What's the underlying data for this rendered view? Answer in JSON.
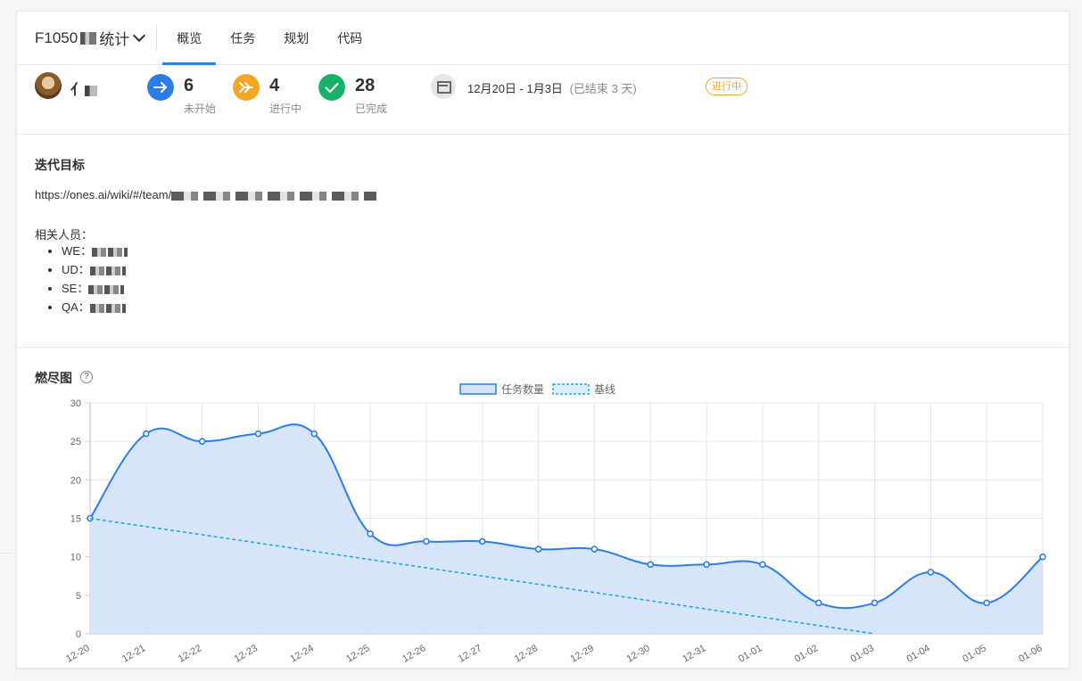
{
  "header": {
    "project_prefix": "F1050",
    "project_suffix": "统计",
    "tabs": [
      {
        "label": "概览",
        "active": true
      },
      {
        "label": "任务",
        "active": false
      },
      {
        "label": "规划",
        "active": false
      },
      {
        "label": "代码",
        "active": false
      }
    ]
  },
  "stats": {
    "not_started": {
      "count": "6",
      "label": "未开始",
      "color": "#2b7de9"
    },
    "in_progress": {
      "count": "4",
      "label": "进行中",
      "color": "#f5a623"
    },
    "done": {
      "count": "28",
      "label": "已完成",
      "color": "#17b26a"
    },
    "date_range": "12月20日 - 1月3日",
    "date_note": "(已结束 3 天)",
    "status": "进行中"
  },
  "goal": {
    "title": "迭代目标",
    "link_prefix": "https://ones.ai/wiki/#/team/",
    "members_label": "相关人员：",
    "members": [
      {
        "role": "WE："
      },
      {
        "role": "UD："
      },
      {
        "role": "SE："
      },
      {
        "role": "QA："
      }
    ]
  },
  "chart_section": {
    "title": "燃尽图",
    "help": "?"
  },
  "chart_data": {
    "type": "line",
    "title": "",
    "xlabel": "",
    "ylabel": "",
    "ylim": [
      0,
      30
    ],
    "yticks": [
      0,
      5,
      10,
      15,
      20,
      25,
      30
    ],
    "categories": [
      "12-20",
      "12-21",
      "12-22",
      "12-23",
      "12-24",
      "12-25",
      "12-26",
      "12-27",
      "12-28",
      "12-29",
      "12-30",
      "12-31",
      "01-01",
      "01-02",
      "01-03",
      "01-04",
      "01-05",
      "01-06"
    ],
    "series": [
      {
        "name": "任务数量",
        "values": [
          15,
          26,
          25,
          26,
          26,
          13,
          12,
          12,
          11,
          11,
          9,
          9,
          9,
          4,
          4,
          8,
          4,
          10
        ],
        "color": "#2b7de9",
        "fill": "#d3e2fb",
        "style": "solid"
      },
      {
        "name": "基线",
        "values": [
          15,
          13.93,
          12.86,
          11.79,
          10.71,
          9.64,
          8.57,
          7.5,
          6.43,
          5.36,
          4.29,
          3.21,
          2.14,
          1.07,
          0
        ],
        "color": "#22a7d6",
        "style": "dashed"
      }
    ],
    "legend": "top-center",
    "grid": true
  }
}
